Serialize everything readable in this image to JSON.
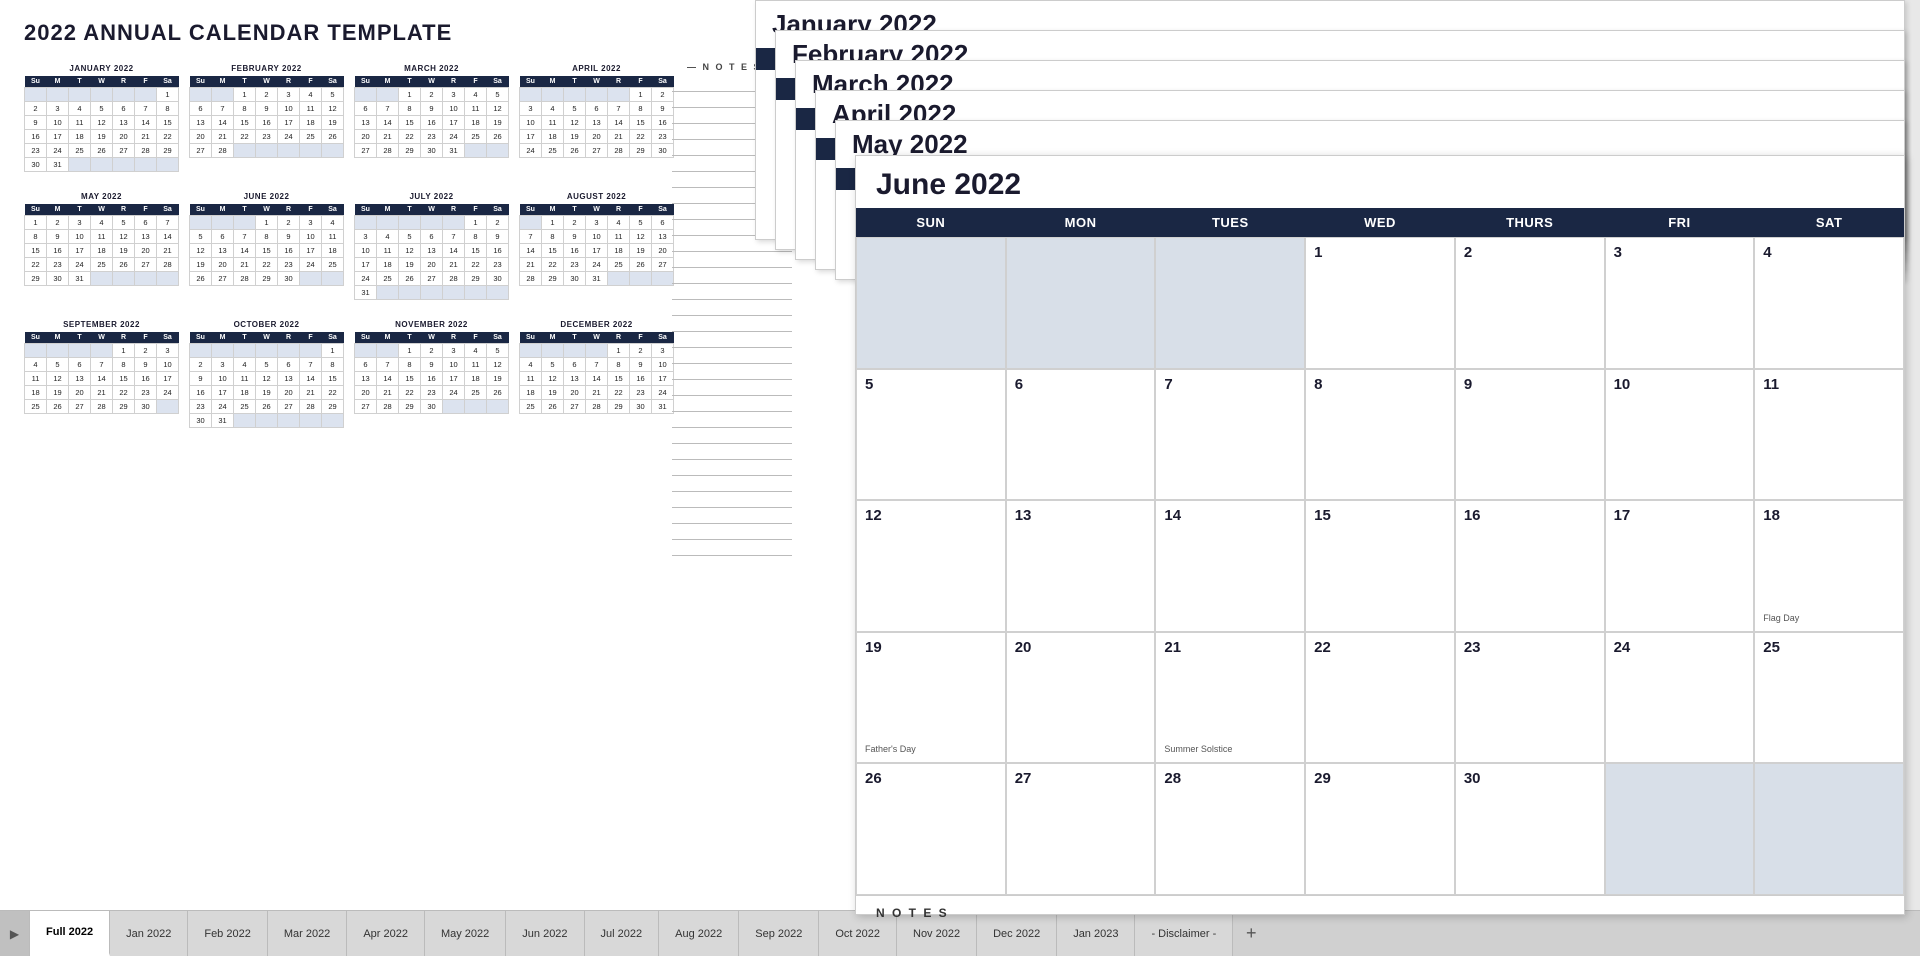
{
  "title": "2022 ANNUAL CALENDAR TEMPLATE",
  "notes_label": "— N O T E S —",
  "miniCalendars": [
    {
      "name": "JANUARY 2022",
      "headers": [
        "Su",
        "M",
        "T",
        "W",
        "R",
        "F",
        "Sa"
      ],
      "weeks": [
        [
          "",
          "",
          "",
          "",
          "",
          "",
          "1"
        ],
        [
          "2",
          "3",
          "4",
          "5",
          "6",
          "7",
          "8"
        ],
        [
          "9",
          "10",
          "11",
          "12",
          "13",
          "14",
          "15"
        ],
        [
          "16",
          "17",
          "18",
          "19",
          "20",
          "21",
          "22"
        ],
        [
          "23",
          "24",
          "25",
          "26",
          "27",
          "28",
          "29"
        ],
        [
          "30",
          "31",
          "",
          "",
          "",
          "",
          ""
        ]
      ],
      "emptyStart": 6
    },
    {
      "name": "FEBRUARY 2022",
      "headers": [
        "Su",
        "M",
        "T",
        "W",
        "R",
        "F",
        "Sa"
      ],
      "weeks": [
        [
          "",
          "",
          "1",
          "2",
          "3",
          "4",
          "5"
        ],
        [
          "6",
          "7",
          "8",
          "9",
          "10",
          "11",
          "12"
        ],
        [
          "13",
          "14",
          "15",
          "16",
          "17",
          "18",
          "19"
        ],
        [
          "20",
          "21",
          "22",
          "23",
          "24",
          "25",
          "26"
        ],
        [
          "27",
          "28",
          "",
          "",
          "",
          "",
          ""
        ]
      ],
      "emptyStart": 2
    },
    {
      "name": "MARCH 2022",
      "headers": [
        "Su",
        "M",
        "T",
        "W",
        "R",
        "F",
        "Sa"
      ],
      "weeks": [
        [
          "",
          "",
          "1",
          "2",
          "3",
          "4",
          "5"
        ],
        [
          "6",
          "7",
          "8",
          "9",
          "10",
          "11",
          "12"
        ],
        [
          "13",
          "14",
          "15",
          "16",
          "17",
          "18",
          "19"
        ],
        [
          "20",
          "21",
          "22",
          "23",
          "24",
          "25",
          "26"
        ],
        [
          "27",
          "28",
          "29",
          "30",
          "31",
          "",
          ""
        ]
      ]
    },
    {
      "name": "APRIL 2022",
      "headers": [
        "Su",
        "M",
        "T",
        "W",
        "R",
        "F",
        "Sa"
      ],
      "weeks": [
        [
          "",
          "",
          "",
          "",
          "",
          "1",
          "2"
        ],
        [
          "3",
          "4",
          "5",
          "6",
          "7",
          "8",
          "9"
        ],
        [
          "10",
          "11",
          "12",
          "13",
          "14",
          "15",
          "16"
        ],
        [
          "17",
          "18",
          "19",
          "20",
          "21",
          "22",
          "23"
        ],
        [
          "24",
          "25",
          "26",
          "27",
          "28",
          "29",
          "30"
        ]
      ]
    },
    {
      "name": "MAY 2022",
      "headers": [
        "Su",
        "M",
        "T",
        "W",
        "R",
        "F",
        "Sa"
      ],
      "weeks": [
        [
          "1",
          "2",
          "3",
          "4",
          "5",
          "6",
          "7"
        ],
        [
          "8",
          "9",
          "10",
          "11",
          "12",
          "13",
          "14"
        ],
        [
          "15",
          "16",
          "17",
          "18",
          "19",
          "20",
          "21"
        ],
        [
          "22",
          "23",
          "24",
          "25",
          "26",
          "27",
          "28"
        ],
        [
          "29",
          "30",
          "31",
          "",
          "",
          "",
          ""
        ]
      ]
    },
    {
      "name": "JUNE 2022",
      "headers": [
        "Su",
        "M",
        "T",
        "W",
        "R",
        "F",
        "Sa"
      ],
      "weeks": [
        [
          "",
          "",
          "",
          "1",
          "2",
          "3",
          "4"
        ],
        [
          "5",
          "6",
          "7",
          "8",
          "9",
          "10",
          "11"
        ],
        [
          "12",
          "13",
          "14",
          "15",
          "16",
          "17",
          "18"
        ],
        [
          "19",
          "20",
          "21",
          "22",
          "23",
          "24",
          "25"
        ],
        [
          "26",
          "27",
          "28",
          "29",
          "30",
          "",
          ""
        ]
      ]
    },
    {
      "name": "JULY 2022",
      "headers": [
        "Su",
        "M",
        "T",
        "W",
        "R",
        "F",
        "Sa"
      ],
      "weeks": [
        [
          "",
          "",
          "",
          "",
          "",
          "1",
          "2"
        ],
        [
          "3",
          "4",
          "5",
          "6",
          "7",
          "8",
          "9"
        ],
        [
          "10",
          "11",
          "12",
          "13",
          "14",
          "15",
          "16"
        ],
        [
          "17",
          "18",
          "19",
          "20",
          "21",
          "22",
          "23"
        ],
        [
          "24",
          "25",
          "26",
          "27",
          "28",
          "29",
          "30"
        ],
        [
          "31",
          "",
          "",
          "",
          "",
          "",
          ""
        ]
      ]
    },
    {
      "name": "AUGUST 2022",
      "headers": [
        "Su",
        "M",
        "T",
        "W",
        "R",
        "F",
        "Sa"
      ],
      "weeks": [
        [
          "",
          "1",
          "2",
          "3",
          "4",
          "5",
          "6"
        ],
        [
          "7",
          "8",
          "9",
          "10",
          "11",
          "12",
          "13"
        ],
        [
          "14",
          "15",
          "16",
          "17",
          "18",
          "19",
          "20"
        ],
        [
          "21",
          "22",
          "23",
          "24",
          "25",
          "26",
          "27"
        ],
        [
          "28",
          "29",
          "30",
          "31",
          "",
          "",
          ""
        ]
      ]
    },
    {
      "name": "SEPTEMBER 2022",
      "headers": [
        "Su",
        "M",
        "T",
        "W",
        "R",
        "F",
        "Sa"
      ],
      "weeks": [
        [
          "",
          "",
          "",
          "",
          "1",
          "2",
          "3"
        ],
        [
          "4",
          "5",
          "6",
          "7",
          "8",
          "9",
          "10"
        ],
        [
          "11",
          "12",
          "13",
          "14",
          "15",
          "16",
          "17"
        ],
        [
          "18",
          "19",
          "20",
          "21",
          "22",
          "23",
          "24"
        ],
        [
          "25",
          "26",
          "27",
          "28",
          "29",
          "30",
          ""
        ]
      ]
    },
    {
      "name": "OCTOBER 2022",
      "headers": [
        "Su",
        "M",
        "T",
        "W",
        "R",
        "F",
        "Sa"
      ],
      "weeks": [
        [
          "",
          "",
          "",
          "",
          "",
          "",
          "1"
        ],
        [
          "2",
          "3",
          "4",
          "5",
          "6",
          "7",
          "8"
        ],
        [
          "9",
          "10",
          "11",
          "12",
          "13",
          "14",
          "15"
        ],
        [
          "16",
          "17",
          "18",
          "19",
          "20",
          "21",
          "22"
        ],
        [
          "23",
          "24",
          "25",
          "26",
          "27",
          "28",
          "29"
        ],
        [
          "30",
          "31",
          "",
          "",
          "",
          "",
          ""
        ]
      ]
    },
    {
      "name": "NOVEMBER 2022",
      "headers": [
        "Su",
        "M",
        "T",
        "W",
        "R",
        "F",
        "Sa"
      ],
      "weeks": [
        [
          "",
          "",
          "1",
          "2",
          "3",
          "4",
          "5"
        ],
        [
          "6",
          "7",
          "8",
          "9",
          "10",
          "11",
          "12"
        ],
        [
          "13",
          "14",
          "15",
          "16",
          "17",
          "18",
          "19"
        ],
        [
          "20",
          "21",
          "22",
          "23",
          "24",
          "25",
          "26"
        ],
        [
          "27",
          "28",
          "29",
          "30",
          "",
          "",
          ""
        ]
      ]
    },
    {
      "name": "DECEMBER 2022",
      "headers": [
        "Su",
        "M",
        "T",
        "W",
        "R",
        "F",
        "Sa"
      ],
      "weeks": [
        [
          "",
          "",
          "",
          "",
          "1",
          "2",
          "3"
        ],
        [
          "4",
          "5",
          "6",
          "7",
          "8",
          "9",
          "10"
        ],
        [
          "11",
          "12",
          "13",
          "14",
          "15",
          "16",
          "17"
        ],
        [
          "18",
          "19",
          "20",
          "21",
          "22",
          "23",
          "24"
        ],
        [
          "25",
          "26",
          "27",
          "28",
          "29",
          "30",
          "31"
        ]
      ]
    }
  ],
  "stackedMonths": [
    {
      "title": "January 2022"
    },
    {
      "title": "February 2022"
    },
    {
      "title": "March 2022"
    },
    {
      "title": "April 2022"
    },
    {
      "title": "May 2022"
    }
  ],
  "juneCalendar": {
    "title": "June 2022",
    "headers": [
      "SUN",
      "MON",
      "TUES",
      "WED",
      "THURS",
      "FRI",
      "SAT"
    ],
    "weeks": [
      [
        {
          "day": "",
          "empty": true
        },
        {
          "day": "",
          "empty": true
        },
        {
          "day": "",
          "empty": true
        },
        {
          "day": "1"
        },
        {
          "day": "2"
        },
        {
          "day": "3"
        },
        {
          "day": "4"
        }
      ],
      [
        {
          "day": "5"
        },
        {
          "day": "6"
        },
        {
          "day": "7"
        },
        {
          "day": "8"
        },
        {
          "day": "9"
        },
        {
          "day": "10"
        },
        {
          "day": "11"
        }
      ],
      [
        {
          "day": "12"
        },
        {
          "day": "13"
        },
        {
          "day": "14"
        },
        {
          "day": "15"
        },
        {
          "day": "16"
        },
        {
          "day": "17"
        },
        {
          "day": "18",
          "event": "Flag Day"
        }
      ],
      [
        {
          "day": "19",
          "event": "Father's Day"
        },
        {
          "day": "20"
        },
        {
          "day": "21",
          "event": "Summer Solstice"
        },
        {
          "day": "22"
        },
        {
          "day": "23"
        },
        {
          "day": "24"
        },
        {
          "day": "25"
        }
      ],
      [
        {
          "day": "26"
        },
        {
          "day": "27"
        },
        {
          "day": "28"
        },
        {
          "day": "29"
        },
        {
          "day": "30"
        },
        {
          "day": "",
          "empty": true
        },
        {
          "day": "",
          "empty": true
        }
      ]
    ]
  },
  "tabs": [
    {
      "label": "Full 2022",
      "active": true
    },
    {
      "label": "Jan 2022"
    },
    {
      "label": "Feb 2022"
    },
    {
      "label": "Mar 2022"
    },
    {
      "label": "Apr 2022"
    },
    {
      "label": "May 2022"
    },
    {
      "label": "Jun 2022"
    },
    {
      "label": "Jul 2022"
    },
    {
      "label": "Aug 2022"
    },
    {
      "label": "Sep 2022"
    },
    {
      "label": "Oct 2022"
    },
    {
      "label": "Nov 2022"
    },
    {
      "label": "Dec 2022"
    },
    {
      "label": "Jan 2023"
    },
    {
      "label": "- Disclaimer -"
    }
  ]
}
